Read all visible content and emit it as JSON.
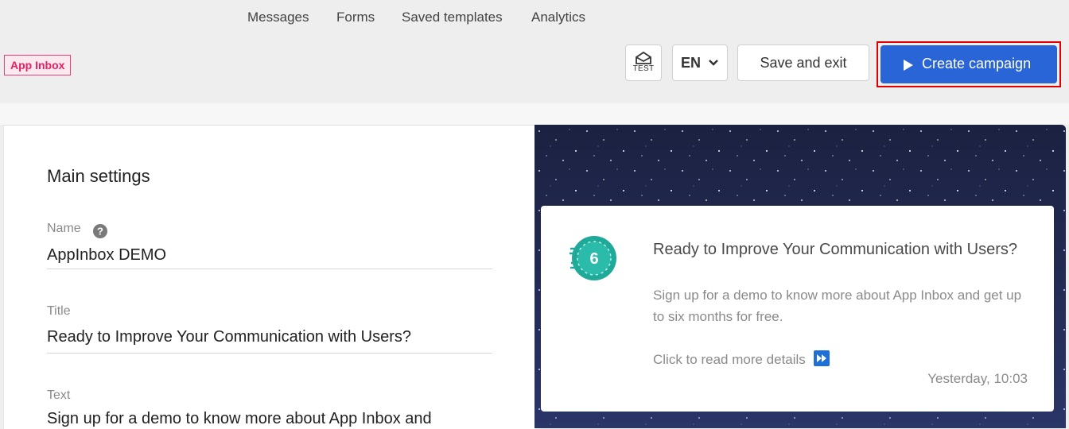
{
  "topnav": {
    "items": [
      {
        "label": "Messages"
      },
      {
        "label": "Forms"
      },
      {
        "label": "Saved templates"
      },
      {
        "label": "Analytics"
      }
    ]
  },
  "header": {
    "badge": "App Inbox",
    "test_label": "TEST",
    "lang": "EN",
    "save_label": "Save and exit",
    "create_label": "Create campaign",
    "colors": {
      "primary": "#2a65d8",
      "highlight": "#e00000",
      "badge": "#e91e63"
    }
  },
  "settings": {
    "title": "Main settings",
    "name_label": "Name",
    "name_value": "AppInbox DEMO",
    "title_label": "Title",
    "title_value": "Ready to Improve Your Communication with Users?",
    "text_label": "Text",
    "text_value": "Sign up for a demo to know more about App Inbox and"
  },
  "preview": {
    "icon_number": "6",
    "title": "Ready to Improve Your Communication with Users?",
    "text": "Sign up for a demo to know more about App Inbox and get up to six months for free.",
    "link": "Click to read more details",
    "time": "Yesterday, 10:03"
  }
}
